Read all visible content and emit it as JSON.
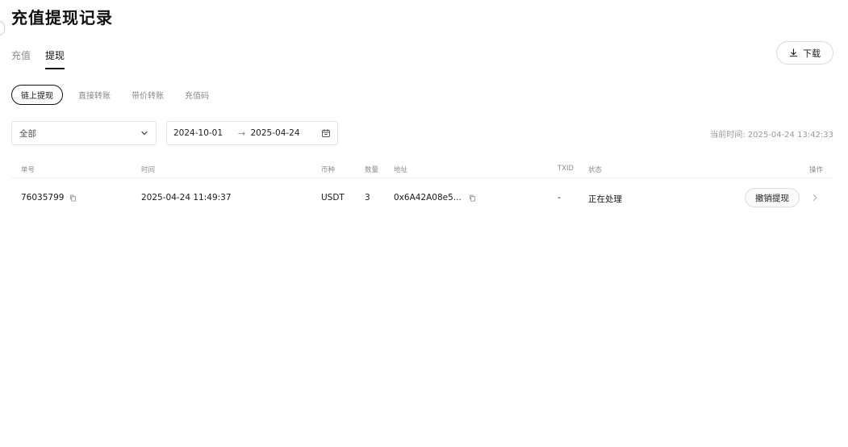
{
  "page_title": "充值提现记录",
  "main_tabs": [
    {
      "label": "充值",
      "active": false
    },
    {
      "label": "提现",
      "active": true
    }
  ],
  "download_label": "下载",
  "sub_tabs": [
    {
      "label": "链上提现",
      "active": true
    },
    {
      "label": "直接转账",
      "active": false
    },
    {
      "label": "带价转账",
      "active": false
    },
    {
      "label": "充值码",
      "active": false
    }
  ],
  "filter": {
    "select_value": "全部",
    "date_start": "2024-10-01",
    "date_end": "2025-04-24"
  },
  "current_time": "当前时间: 2025-04-24 13:42:33",
  "table": {
    "headers": {
      "order": "单号",
      "time": "时间",
      "coin": "币种",
      "qty": "数量",
      "address": "地址",
      "txid": "TXID",
      "status": "状态",
      "action": "操作"
    },
    "rows": [
      {
        "order": "76035799",
        "time": "2025-04-24 11:49:37",
        "coin": "USDT",
        "qty": "3",
        "address": "0x6A42A08e5...",
        "txid": "-",
        "status": "正在处理",
        "action_label": "撤销提现"
      }
    ]
  },
  "icons": {
    "download": "download-icon",
    "dropdown": "chevron-down-icon",
    "arrow": "arrow-right-icon",
    "calendar": "calendar-icon",
    "copy": "copy-icon",
    "row_chevron": "chevron-right-icon"
  }
}
